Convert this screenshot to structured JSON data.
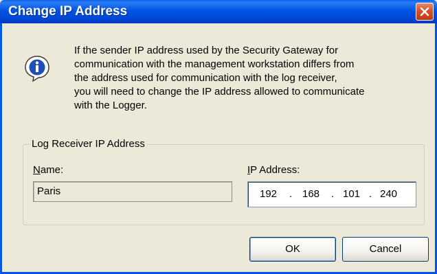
{
  "window": {
    "title": "Change IP Address"
  },
  "message": {
    "lines": [
      "If the sender IP address used by the Security Gateway for",
      "communication with the management workstation differs from",
      "the address used for communication with the log receiver,",
      "you will need to change the IP address allowed to communicate",
      "with the Logger."
    ]
  },
  "group": {
    "legend": "Log Receiver IP Address",
    "name_label_mnemonic": "N",
    "name_label_rest": "ame:",
    "name_value": "Paris",
    "ip_label_mnemonic": "I",
    "ip_label_rest": "P Address:",
    "ip_octets": [
      "192",
      "168",
      "101",
      "240"
    ],
    "ip_separator": "."
  },
  "buttons": {
    "ok": "OK",
    "cancel": "Cancel"
  },
  "icons": {
    "close": "close-icon",
    "info": "info-icon"
  },
  "colors": {
    "titlebar": "#0054e3",
    "close_button": "#d6502c",
    "dialog_bg": "#ece9d8"
  }
}
